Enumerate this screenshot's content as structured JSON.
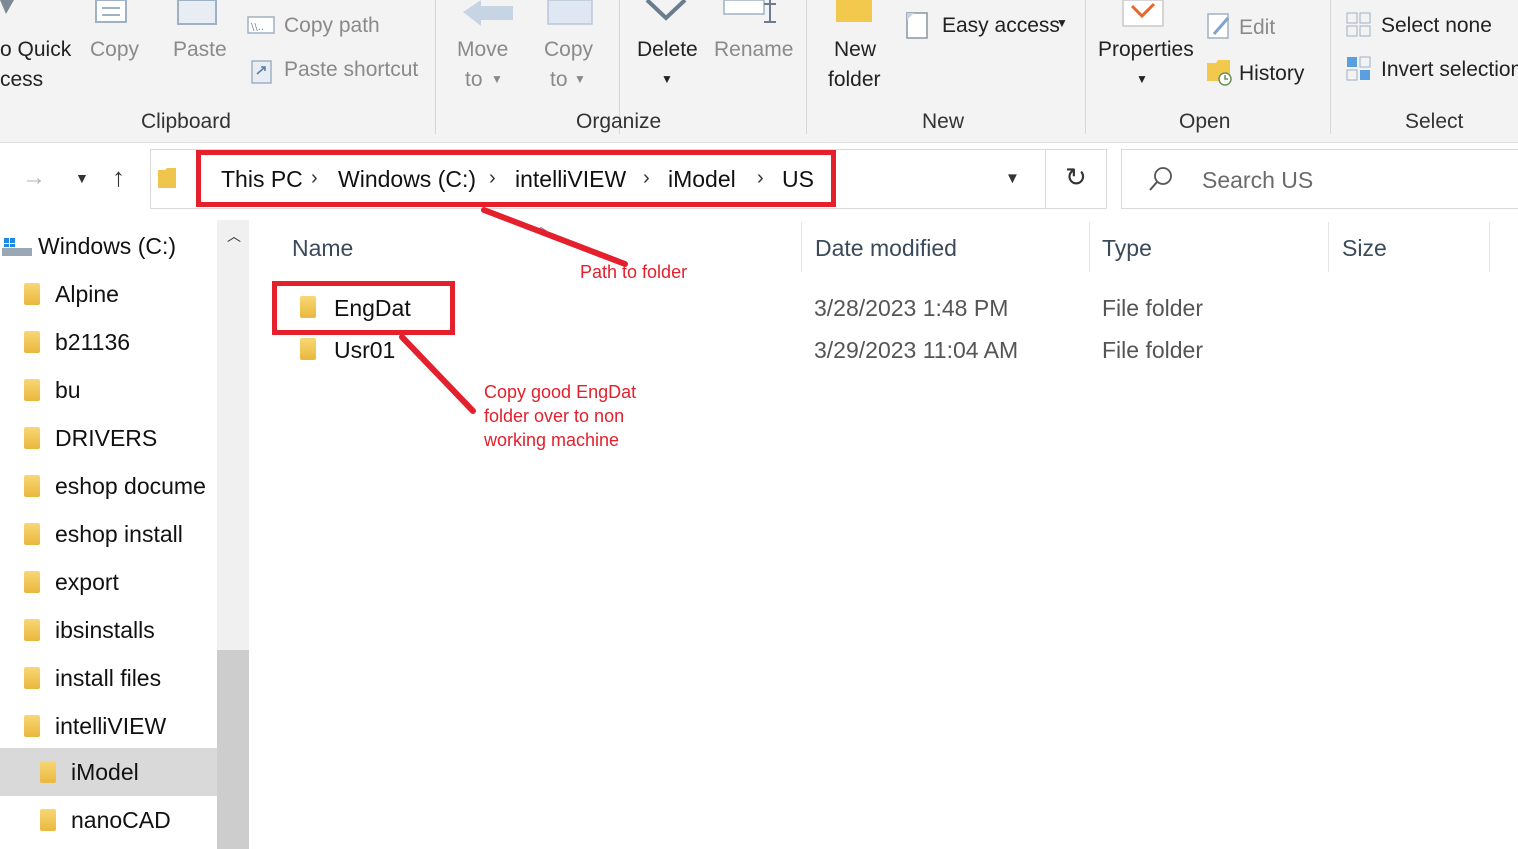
{
  "ribbon": {
    "clipboard": {
      "group_label": "Clipboard",
      "pin_quick_access_line1": "o Quick",
      "pin_quick_access_line2": "cess",
      "copy": "Copy",
      "paste": "Paste",
      "copy_path": "Copy path",
      "paste_shortcut": "Paste shortcut"
    },
    "organize": {
      "group_label": "Organize",
      "move_to_line1": "Move",
      "move_to_line2": "to",
      "copy_to_line1": "Copy",
      "copy_to_line2": "to",
      "delete": "Delete",
      "rename": "Rename"
    },
    "new": {
      "group_label": "New",
      "new_folder_line1": "New",
      "new_folder_line2": "folder",
      "easy_access": "Easy access"
    },
    "open": {
      "group_label": "Open",
      "properties": "Properties",
      "edit": "Edit",
      "history": "History"
    },
    "select": {
      "group_label": "Select",
      "select_none": "Select none",
      "invert_selection": "Invert selection"
    }
  },
  "address": {
    "crumbs": [
      "This PC",
      "Windows (C:)",
      "intelliVIEW",
      "iModel",
      "US"
    ],
    "search_placeholder": "Search US"
  },
  "nav": {
    "drive": "Windows (C:)",
    "items": [
      "Alpine",
      "b21136",
      "bu",
      "DRIVERS",
      "eshop docume",
      "eshop install",
      "export",
      "ibsinstalls",
      "install files",
      "intelliVIEW"
    ],
    "sub_items": [
      "iModel",
      "nanoCAD"
    ]
  },
  "columns": {
    "name": "Name",
    "date_modified": "Date modified",
    "type": "Type",
    "size": "Size"
  },
  "files": [
    {
      "name": "EngDat",
      "date": "3/28/2023 1:48 PM",
      "type": "File folder"
    },
    {
      "name": "Usr01",
      "date": "3/29/2023 11:04 AM",
      "type": "File folder"
    }
  ],
  "annotations": {
    "path_note": "Path to folder",
    "copy_note_line1": "Copy good EngDat",
    "copy_note_line2": "folder over to non",
    "copy_note_line3": "working machine"
  },
  "colors": {
    "annotation_red": "#e3202c",
    "folder_yellow": "#f0c54e",
    "selected_bg": "#d9d9d9"
  }
}
